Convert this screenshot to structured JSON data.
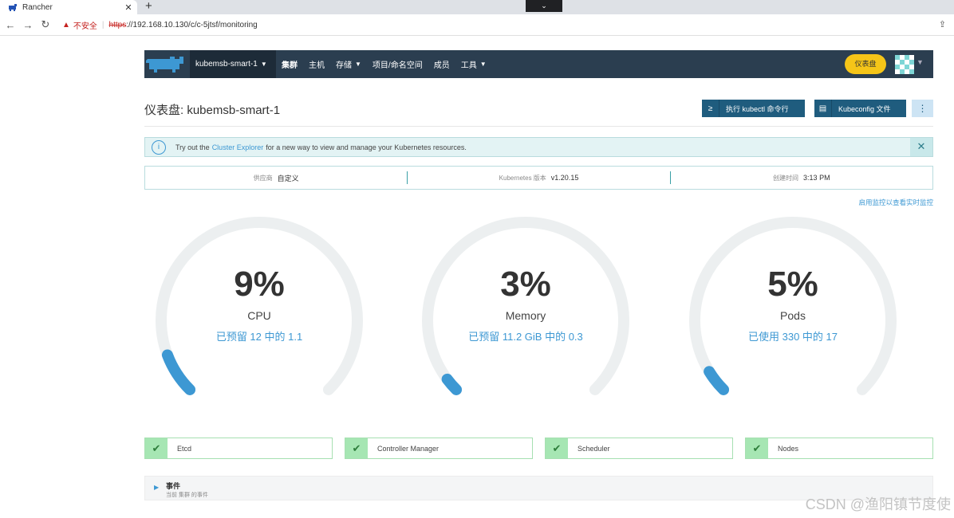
{
  "browser": {
    "tab_title": "Rancher",
    "tab_close": "✕",
    "new_tab": "+",
    "tab_search": "⌄",
    "back": "←",
    "forward": "→",
    "reload": "↻",
    "insecure_label": "不安全",
    "url_scheme": "https",
    "url_rest": "://192.168.10.130/c/c-5jtsf/monitoring"
  },
  "header": {
    "cluster_name": "kubemsb-smart-1",
    "nav": [
      {
        "label": "集群"
      },
      {
        "label": "主机"
      },
      {
        "label": "存储"
      },
      {
        "label": "项目/命名空间"
      },
      {
        "label": "成员"
      },
      {
        "label": "工具"
      }
    ],
    "dashboard_button": "仪表盘"
  },
  "page": {
    "title": "仪表盘: kubemsb-smart-1",
    "kubectl_button": "执行 kubectl 命令行",
    "kubeconfig_button": "Kubeconfig 文件"
  },
  "banner": {
    "prefix": "Try out the",
    "link": "Cluster Explorer",
    "suffix": "for a new way to view and manage your Kubernetes resources."
  },
  "info": {
    "provider_label": "供应商",
    "provider_value": "自定义",
    "k8s_label": "Kubernetes 版本",
    "k8s_value": "v1.20.15",
    "created_label": "创建时间",
    "created_value": "3:13 PM"
  },
  "monitor_link": "启用监控以查看实时监控",
  "gauges": [
    {
      "percent": "9%",
      "value": 0.09,
      "name": "CPU",
      "detail": "已预留 12 中的 1.1"
    },
    {
      "percent": "3%",
      "value": 0.03,
      "name": "Memory",
      "detail": "已预留 11.2 GiB 中的 0.3"
    },
    {
      "percent": "5%",
      "value": 0.05,
      "name": "Pods",
      "detail": "已使用 330 中的 17"
    }
  ],
  "components": [
    {
      "label": "Etcd"
    },
    {
      "label": "Controller Manager"
    },
    {
      "label": "Scheduler"
    },
    {
      "label": "Nodes"
    }
  ],
  "events": {
    "title": "事件",
    "subtitle": "当前 集群 的事件"
  },
  "watermark": "CSDN @渔阳镇节度使",
  "colors": {
    "gauge_track": "#eceff0",
    "gauge_fill": "#3d98d3",
    "header_bg": "#2b3e50",
    "accent_yellow": "#f5c518"
  }
}
